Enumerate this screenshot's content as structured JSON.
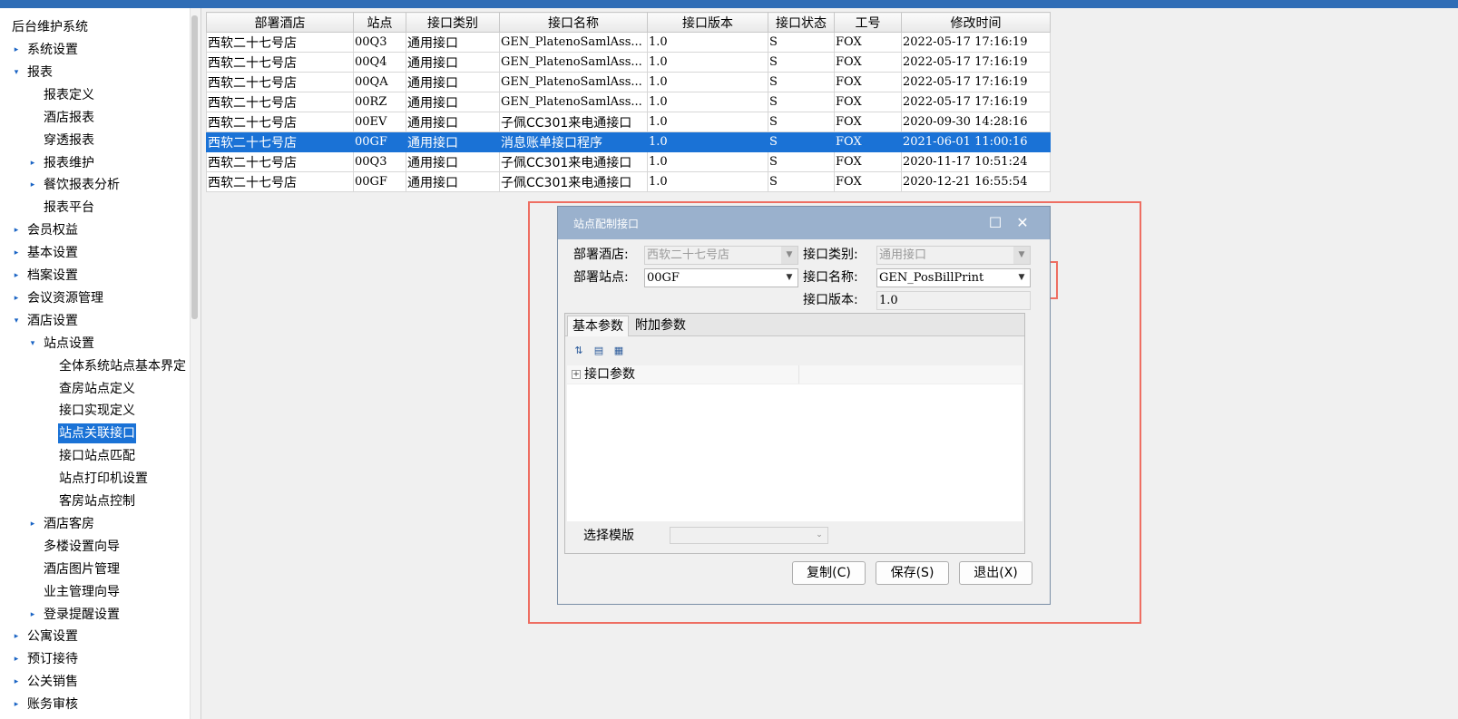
{
  "sidebar": {
    "root_label": "后台维护系统",
    "items": [
      {
        "label": "系统设置",
        "arrow": "▸"
      },
      {
        "label": "报表",
        "arrow": "▾"
      },
      {
        "label": "报表定义",
        "arrow": ""
      },
      {
        "label": "酒店报表",
        "arrow": ""
      },
      {
        "label": "穿透报表",
        "arrow": ""
      },
      {
        "label": "报表维护",
        "arrow": "▸"
      },
      {
        "label": "餐饮报表分析",
        "arrow": "▸"
      },
      {
        "label": "报表平台",
        "arrow": ""
      },
      {
        "label": "会员权益",
        "arrow": "▸"
      },
      {
        "label": "基本设置",
        "arrow": "▸"
      },
      {
        "label": "档案设置",
        "arrow": "▸"
      },
      {
        "label": "会议资源管理",
        "arrow": "▸"
      },
      {
        "label": "酒店设置",
        "arrow": "▾"
      },
      {
        "label": "站点设置",
        "arrow": "▾"
      },
      {
        "label": "全体系统站点基本界定",
        "arrow": ""
      },
      {
        "label": "查房站点定义",
        "arrow": ""
      },
      {
        "label": "接口实现定义",
        "arrow": ""
      },
      {
        "label": "站点关联接口",
        "arrow": ""
      },
      {
        "label": "接口站点匹配",
        "arrow": ""
      },
      {
        "label": "站点打印机设置",
        "arrow": ""
      },
      {
        "label": "客房站点控制",
        "arrow": ""
      },
      {
        "label": "酒店客房",
        "arrow": "▸"
      },
      {
        "label": "多楼设置向导",
        "arrow": ""
      },
      {
        "label": "酒店图片管理",
        "arrow": ""
      },
      {
        "label": "业主管理向导",
        "arrow": ""
      },
      {
        "label": "登录提醒设置",
        "arrow": "▸"
      },
      {
        "label": "公寓设置",
        "arrow": "▸"
      },
      {
        "label": "预订接待",
        "arrow": "▸"
      },
      {
        "label": "公关销售",
        "arrow": "▸"
      },
      {
        "label": "账务审核",
        "arrow": "▸"
      }
    ]
  },
  "grid": {
    "columns": [
      "部署酒店",
      "站点",
      "接口类别",
      "接口名称",
      "接口版本",
      "接口状态",
      "工号",
      "修改时间"
    ],
    "rows": [
      [
        "西软二十七号店",
        "00Q3",
        "通用接口",
        "GEN_PlatenoSamlAss...",
        "1.0",
        "S",
        "FOX",
        "2022-05-17 17:16:19"
      ],
      [
        "西软二十七号店",
        "00Q4",
        "通用接口",
        "GEN_PlatenoSamlAss...",
        "1.0",
        "S",
        "FOX",
        "2022-05-17 17:16:19"
      ],
      [
        "西软二十七号店",
        "00QA",
        "通用接口",
        "GEN_PlatenoSamlAss...",
        "1.0",
        "S",
        "FOX",
        "2022-05-17 17:16:19"
      ],
      [
        "西软二十七号店",
        "00RZ",
        "通用接口",
        "GEN_PlatenoSamlAss...",
        "1.0",
        "S",
        "FOX",
        "2022-05-17 17:16:19"
      ],
      [
        "西软二十七号店",
        "00EV",
        "通用接口",
        "子佩CC301来电通接口",
        "1.0",
        "S",
        "FOX",
        "2020-09-30 14:28:16"
      ],
      [
        "西软二十七号店",
        "00GF",
        "通用接口",
        "消息账单接口程序",
        "1.0",
        "S",
        "FOX",
        "2021-06-01 11:00:16"
      ],
      [
        "西软二十七号店",
        "00Q3",
        "通用接口",
        "子佩CC301来电通接口",
        "1.0",
        "S",
        "FOX",
        "2020-11-17 10:51:24"
      ],
      [
        "西软二十七号店",
        "00GF",
        "通用接口",
        "子佩CC301来电通接口",
        "1.0",
        "S",
        "FOX",
        "2020-12-21 16:55:54"
      ]
    ],
    "selected_row": 5
  },
  "dialog": {
    "title": "站点配制接口",
    "maximize_glyph": "☐",
    "close_glyph": "✕",
    "hotel_label": "部署酒店:",
    "hotel_value": "西软二十七号店",
    "station_label": "部署站点:",
    "station_value": "00GF",
    "category_label": "接口类别:",
    "category_value": "通用接口",
    "name_label": "接口名称:",
    "name_value": "GEN_PosBillPrint",
    "version_label": "接口版本:",
    "version_value": "1.0",
    "tabs": [
      "基本参数",
      "附加参数"
    ],
    "property_group": "接口参数",
    "template_label": "选择模版",
    "template_value": "",
    "buttons": {
      "copy": "复制(C)",
      "save": "保存(S)",
      "exit": "退出(X)"
    }
  },
  "colors": {
    "selection": "#1a72d6",
    "highlight_box": "#ee6e62",
    "titlebar": "#9ab1cd"
  }
}
